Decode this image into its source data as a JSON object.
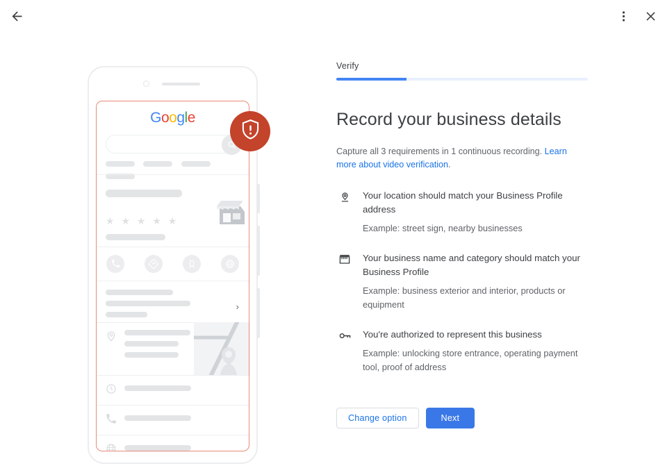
{
  "window": {
    "back_icon": "arrow-back-icon",
    "more_icon": "more-vert-icon",
    "close_icon": "close-icon"
  },
  "panel": {
    "tab_label": "Verify",
    "progress_percent": 28,
    "title": "Record your business details",
    "description_prefix": "Capture all 3 requirements in 1 continuous recording. ",
    "description_link": "Learn more about video verification",
    "description_suffix": ".",
    "requirements": [
      {
        "icon": "location-pin-icon",
        "title": "Your location should match your Business Profile address",
        "example": "Example: street sign, nearby businesses"
      },
      {
        "icon": "storefront-icon",
        "title": "Your business name and category should match your Business Profile",
        "example": "Example: business exterior and interior, products or equipment"
      },
      {
        "icon": "key-icon",
        "title": "You're authorized to represent this business",
        "example": "Example: unlocking store entrance, operating payment tool, proof of address"
      }
    ],
    "buttons": {
      "secondary": "Change option",
      "primary": "Next"
    }
  },
  "illustration": {
    "badge_icon": "shield-alert-icon",
    "badge_color": "#C4432B",
    "phone_screen_outline_color": "#E8897A",
    "google_logo": {
      "letters": [
        {
          "char": "G",
          "color": "#4285F4"
        },
        {
          "char": "o",
          "color": "#EA4335"
        },
        {
          "char": "o",
          "color": "#FBBC05"
        },
        {
          "char": "g",
          "color": "#4285F4"
        },
        {
          "char": "l",
          "color": "#34A853"
        },
        {
          "char": "e",
          "color": "#EA4335"
        }
      ]
    },
    "search_icon": "search-icon",
    "rating_stars": "★ ★ ★ ★ ★",
    "action_icons": [
      "call-icon",
      "directions-icon",
      "bookmark-icon",
      "share-globe-icon"
    ],
    "detail_row_icons": [
      "location-pin-icon",
      "clock-icon",
      "phone-icon",
      "globe-icon"
    ],
    "chevron": "›",
    "storefront_icon": "storefront-illustration",
    "map_thumbnail_icon": "map-thumbnail"
  },
  "colors": {
    "accent_blue": "#1A73E8",
    "button_blue": "#3B78E7",
    "progress_track": "#E8F0FE",
    "progress_fill": "#4285F4",
    "badge_red": "#C4432B",
    "text_primary": "#3C4043",
    "text_secondary": "#5F6368",
    "placeholder_grey": "#E2E4E6"
  }
}
